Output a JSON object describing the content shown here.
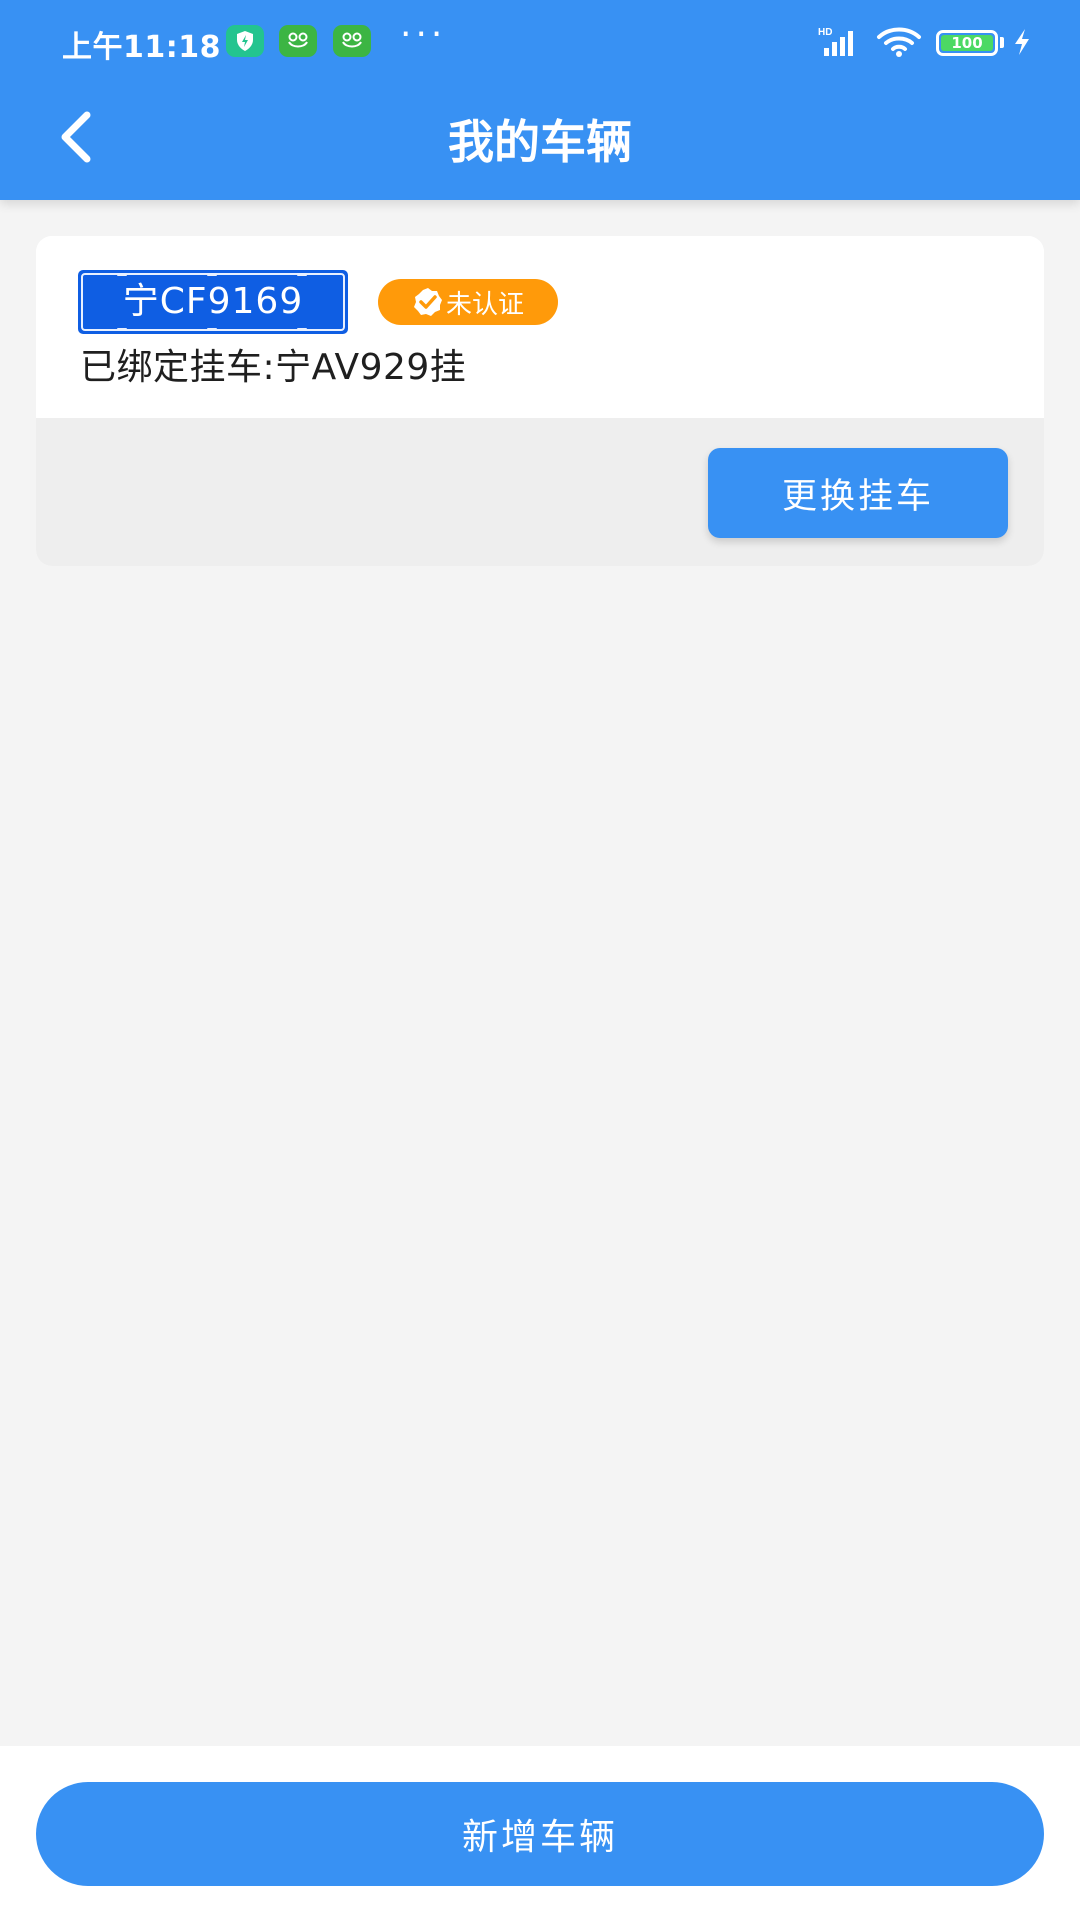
{
  "status_bar": {
    "time": "上午11:18",
    "more": "···",
    "signal_label": "HD",
    "battery_level": "100",
    "icons": [
      "shield-icon",
      "frog-icon",
      "frog-icon",
      "signal-icon",
      "wifi-icon",
      "battery-icon",
      "charging-bolt-icon"
    ]
  },
  "header": {
    "title": "我的车辆",
    "back_icon": "chevron-left-icon"
  },
  "vehicle_card": {
    "plate": "宁CF9169",
    "status_badge": "未认证",
    "status_icon": "verified-badge-icon",
    "bound_trailer": "已绑定挂车:宁AV929挂",
    "change_trailer_button": "更换挂车"
  },
  "footer": {
    "add_vehicle_button": "新增车辆"
  },
  "colors": {
    "primary": "#3891f3",
    "plate_blue": "#0f5ee3",
    "badge_orange": "#ff9a0a",
    "page_bg": "#f4f4f4"
  }
}
